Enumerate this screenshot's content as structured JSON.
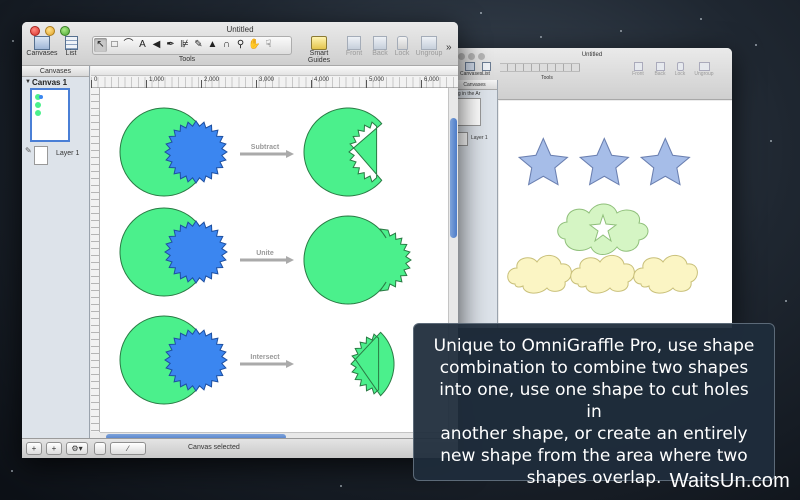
{
  "main_window": {
    "title": "Untitled",
    "toolbar": {
      "canvases_label": "Canvases",
      "list_label": "List",
      "tools_label": "Tools",
      "smart_guides_label": "Smart Guides",
      "front_label": "Front",
      "back_label": "Back",
      "lock_label": "Lock",
      "ungroup_label": "Ungroup"
    },
    "sidebar": {
      "header": "Canvases",
      "canvas_name": "Canvas 1",
      "layer_name": "Layer 1"
    },
    "ruler_ticks": [
      "0",
      "1,000",
      "2,000",
      "3,000",
      "4,000",
      "5,000",
      "6,000"
    ],
    "operations": [
      "Subtract",
      "Unite",
      "Intersect"
    ],
    "status_text": "Canvas selected"
  },
  "back_window": {
    "title": "Untitled",
    "toolbar": {
      "canvases_label": "Canvases",
      "list_label": "List",
      "tools_label": "Tools",
      "front_label": "Front",
      "back_label": "Back",
      "lock_label": "Lock",
      "ungroup_label": "Ungroup"
    },
    "sidebar_header": "Canvases",
    "sidebar_item": "ing in the Ar",
    "layer_name": "Layer 1"
  },
  "callout_lines": [
    "Unique to OmniGraffle Pro, use shape",
    "combination to combine two shapes",
    "into one, use one shape to cut holes in",
    "another shape, or create an entirely",
    "new shape from the area where two",
    "shapes overlap."
  ],
  "watermark": "WaitsUn.com",
  "colors": {
    "green_shape": "#4bf08c",
    "blue_shape": "#3b86f0",
    "star_fill": "#a6bde8",
    "cloud_green": "#d5f5c4",
    "cloud_yellow": "#fbf5c4",
    "callout_bg": "#1f2d3c"
  }
}
